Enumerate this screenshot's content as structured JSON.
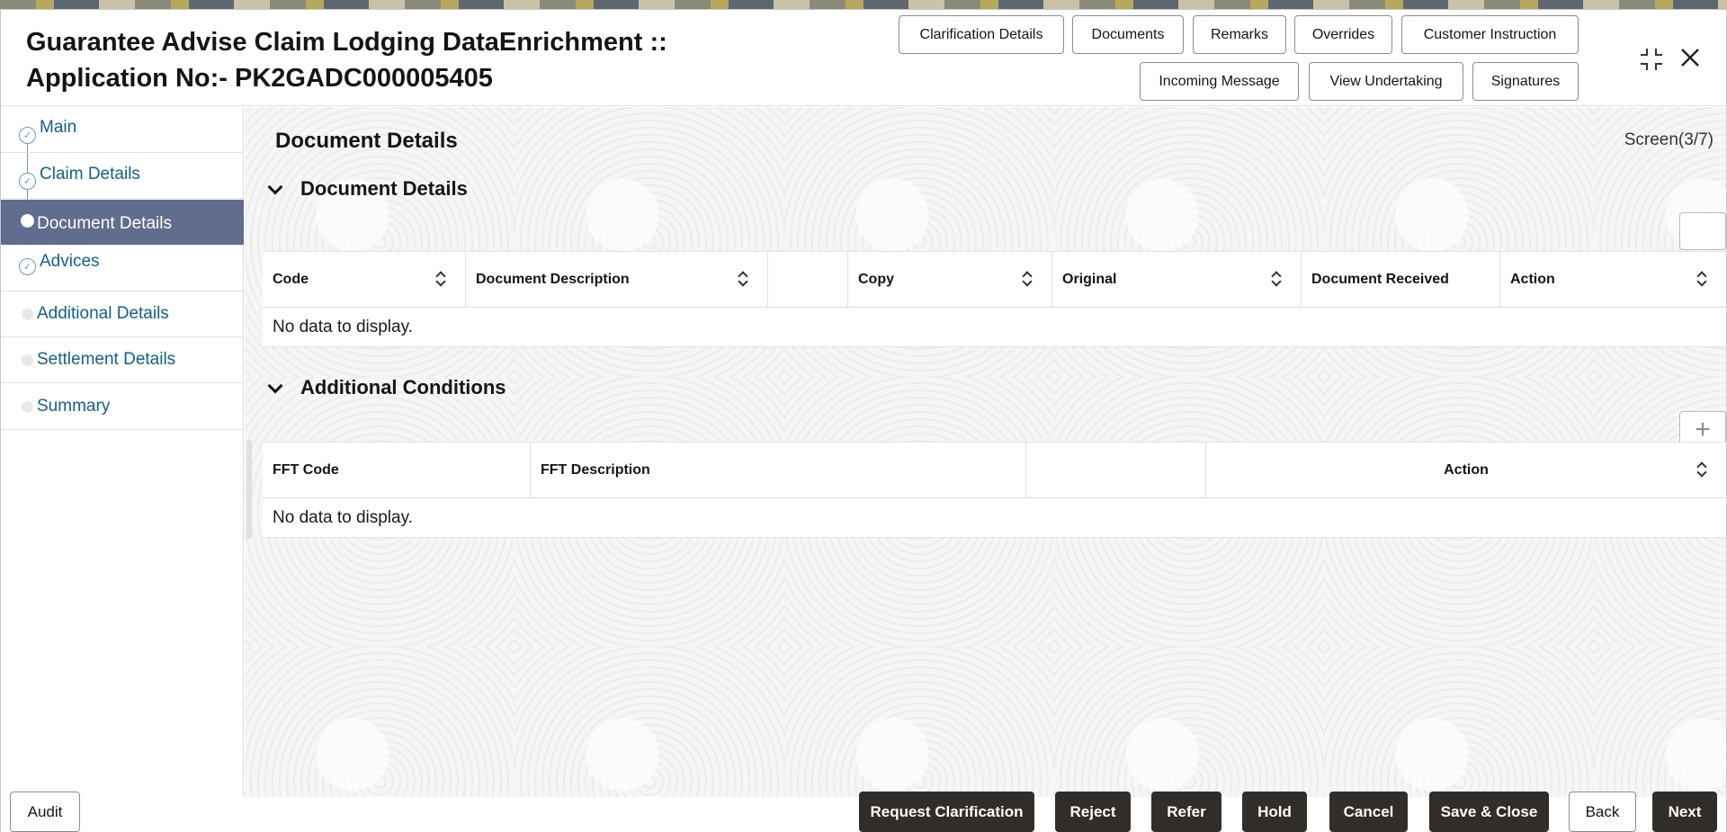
{
  "header": {
    "title_line1": "Guarantee Advise Claim Lodging DataEnrichment ::",
    "title_line2": "Application No:- PK2GADC000005405",
    "buttons_row1": [
      "Clarification Details",
      "Documents",
      "Remarks",
      "Overrides",
      "Customer Instruction"
    ],
    "buttons_row2": [
      "Incoming Message",
      "View Undertaking",
      "Signatures"
    ],
    "icons": [
      "minimize-icon",
      "close-icon"
    ]
  },
  "sidebar": {
    "items": [
      {
        "label": "Main",
        "state": "completed"
      },
      {
        "label": "Claim Details",
        "state": "completed"
      },
      {
        "label": "Document Details",
        "state": "active"
      },
      {
        "label": "Advices",
        "state": "completed"
      },
      {
        "label": "Additional Details",
        "state": "pending"
      },
      {
        "label": "Settlement Details",
        "state": "pending"
      },
      {
        "label": "Summary",
        "state": "pending"
      }
    ]
  },
  "main": {
    "page_title": "Document Details",
    "screen_indicator": "Screen(3/7)",
    "document_section": {
      "title": "Document Details",
      "columns": [
        "Code",
        "Document Description",
        "",
        "Copy",
        "Original",
        "Document Received",
        "Action"
      ],
      "empty_text": "No data to display."
    },
    "conditions_section": {
      "title": "Additional Conditions",
      "columns": [
        "FFT Code",
        "FFT Description",
        "",
        "Action"
      ],
      "empty_text": "No data to display.",
      "add_glyph": "+"
    }
  },
  "footer": {
    "audit": "Audit",
    "buttons": [
      "Request Clarification",
      "Reject",
      "Refer",
      "Hold",
      "Cancel",
      "Save & Close",
      "Back",
      "Next"
    ]
  },
  "colors": {
    "accent_active": "#616d8f",
    "link": "#0d6491",
    "dark_button": "#312d2a"
  }
}
